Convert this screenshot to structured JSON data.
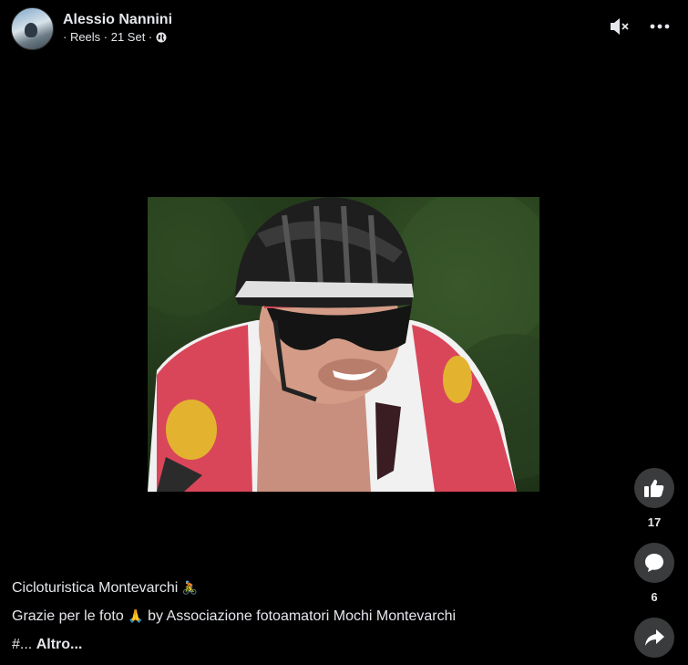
{
  "header": {
    "name": "Alessio Nannini",
    "sub_text": "· Reels · 21 Set ·",
    "audience_icon": "globe-icon"
  },
  "top_actions": [
    {
      "icon": "mute-icon"
    },
    {
      "icon": "more-options-icon"
    }
  ],
  "side_actions": {
    "like_count": "17",
    "comment_count": "6"
  },
  "caption": {
    "line1_text": "Cicloturistica Montevarchi",
    "line1_emoji": "🚴",
    "line2_text": "Grazie per le foto",
    "line2_emoji": "🙏",
    "line2_rest": "by Associazione fotoamatori Mochi Montevarchi",
    "line3_text": "#...",
    "more_label": "Altro..."
  },
  "colors": {
    "background": "#000000",
    "text": "#e4e6eb",
    "button_bg": "#3a3b3c",
    "jersey_red": "#d9465a"
  }
}
